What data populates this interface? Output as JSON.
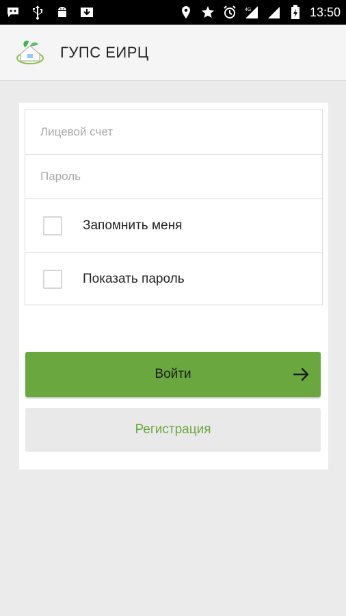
{
  "status_bar": {
    "time": "13:50",
    "left_icons": [
      "chat-icon",
      "usb-icon",
      "android-icon",
      "download-icon"
    ],
    "right_icons": [
      "location-icon",
      "star-icon",
      "alarm-icon",
      "signal-4g-icon",
      "signal-icon",
      "battery-icon"
    ]
  },
  "app_bar": {
    "title": "ГУПС ЕИРЦ",
    "logo": "house-leaf-logo"
  },
  "form": {
    "account_placeholder": "Лицевой счет",
    "account_value": "",
    "password_placeholder": "Пароль",
    "password_value": "",
    "remember_label": "Запомнить меня",
    "remember_checked": false,
    "show_password_label": "Показать пароль",
    "show_password_checked": false
  },
  "buttons": {
    "login_label": "Войти",
    "login_icon": "arrow-right-icon",
    "register_label": "Регистрация"
  },
  "colors": {
    "accent_green": "#6aa83f",
    "status_bar": "#000000",
    "background": "#ebebeb"
  }
}
